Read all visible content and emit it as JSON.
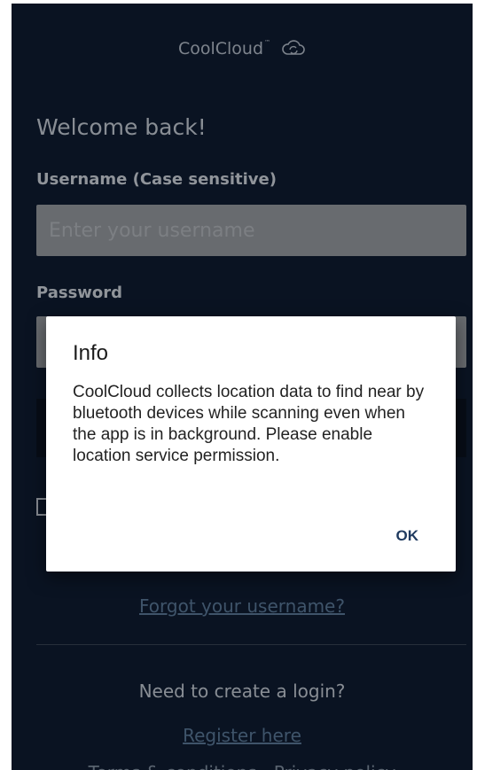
{
  "app": {
    "logo_text": "CoolCloud",
    "logo_tm": "™",
    "logo_icon": "cloud-sync-icon"
  },
  "login": {
    "welcome": "Welcome back!",
    "username_label": "Username (Case sensitive)",
    "username_placeholder": "Enter your username",
    "username_value": "",
    "password_label": "Password",
    "forgot_username": "Forgot your username?",
    "need_login": "Need to create a login?",
    "register": "Register here",
    "terms": "Terms & conditions · Privacy policy"
  },
  "dialog": {
    "title": "Info",
    "message": "CoolCloud collects location data to find near by bluetooth devices while scanning even when the app is in background. Please enable location service permission.",
    "ok_label": "OK"
  },
  "colors": {
    "background": "#0f1d33",
    "field": "#9a9ea4",
    "link": "#5d7c9d",
    "dialog_button": "#1f3a5f"
  }
}
